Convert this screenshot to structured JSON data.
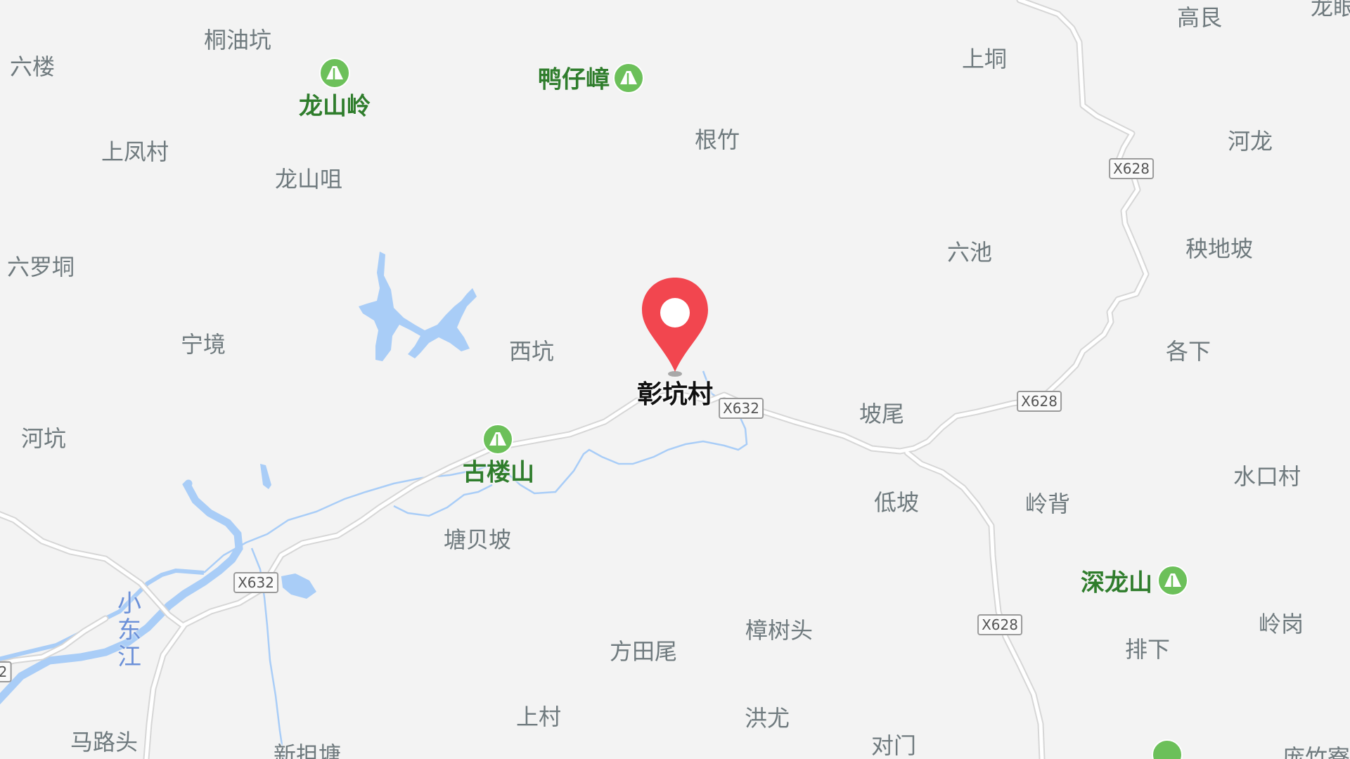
{
  "colors": {
    "land": "#f3f3f3",
    "water": "#a9cdf7",
    "road": "#ffffff",
    "road_casing": "#dcdcdc",
    "mountain_green": "#6cc05a",
    "mountain_text": "#2f7d2c",
    "pin_red": "#f2464f",
    "place_text": "#6f7a7e"
  },
  "places": [
    {
      "id": "tongyoukeng",
      "text": "桐油坑"
    },
    {
      "id": "liulou",
      "text": "六楼"
    },
    {
      "id": "gaoliang",
      "text": "高艮"
    },
    {
      "id": "longyan",
      "text": "龙眼"
    },
    {
      "id": "shangdong",
      "text": "上垌"
    },
    {
      "id": "shangfengcun",
      "text": "上凤村"
    },
    {
      "id": "genzhu",
      "text": "根竹"
    },
    {
      "id": "helong",
      "text": "河龙"
    },
    {
      "id": "longshanju",
      "text": "龙山咀"
    },
    {
      "id": "liuluodong",
      "text": "六罗垌"
    },
    {
      "id": "liuchi",
      "text": "六池"
    },
    {
      "id": "yangdipo",
      "text": "秧地坡"
    },
    {
      "id": "ningjing",
      "text": "宁境"
    },
    {
      "id": "xikeng",
      "text": "西坑"
    },
    {
      "id": "gexia",
      "text": "各下"
    },
    {
      "id": "pown",
      "text": "坡尾"
    },
    {
      "id": "hekeng",
      "text": "河坑"
    },
    {
      "id": "dipo",
      "text": "低坡"
    },
    {
      "id": "lingbei",
      "text": "岭背"
    },
    {
      "id": "shuikoucun",
      "text": "水口村"
    },
    {
      "id": "tangbeipo",
      "text": "塘贝坡"
    },
    {
      "id": "zhangshutou",
      "text": "樟树头"
    },
    {
      "id": "linggang",
      "text": "岭岗"
    },
    {
      "id": "fangtianwei",
      "text": "方田尾"
    },
    {
      "id": "paixia",
      "text": "排下"
    },
    {
      "id": "shangcun",
      "text": "上村"
    },
    {
      "id": "hongyou",
      "text": "洪尤"
    },
    {
      "id": "duimen",
      "text": "对门"
    },
    {
      "id": "malutou",
      "text": "马路头"
    },
    {
      "id": "xinjutang",
      "text": "新担塘"
    },
    {
      "id": "pangzhu",
      "text": "庞竹寮"
    }
  ],
  "mountains": [
    {
      "id": "longshanling",
      "text": "龙山岭"
    },
    {
      "id": "yazizhang",
      "text": "鸭仔嶂"
    },
    {
      "id": "gulousan",
      "text": "古楼山"
    },
    {
      "id": "shenlongshan",
      "text": "深龙山"
    }
  ],
  "road_shields": [
    {
      "id": "x632-east",
      "text": "X632"
    },
    {
      "id": "x632-west",
      "text": "X632"
    },
    {
      "id": "x628-north",
      "text": "X628"
    },
    {
      "id": "x628-mid",
      "text": "X628"
    },
    {
      "id": "x628-south",
      "text": "X628"
    },
    {
      "id": "edge-2",
      "text": "2"
    }
  ],
  "river": {
    "name": "小东江"
  },
  "marker": {
    "label": "彰坑村",
    "icon": "map-pin-icon"
  }
}
